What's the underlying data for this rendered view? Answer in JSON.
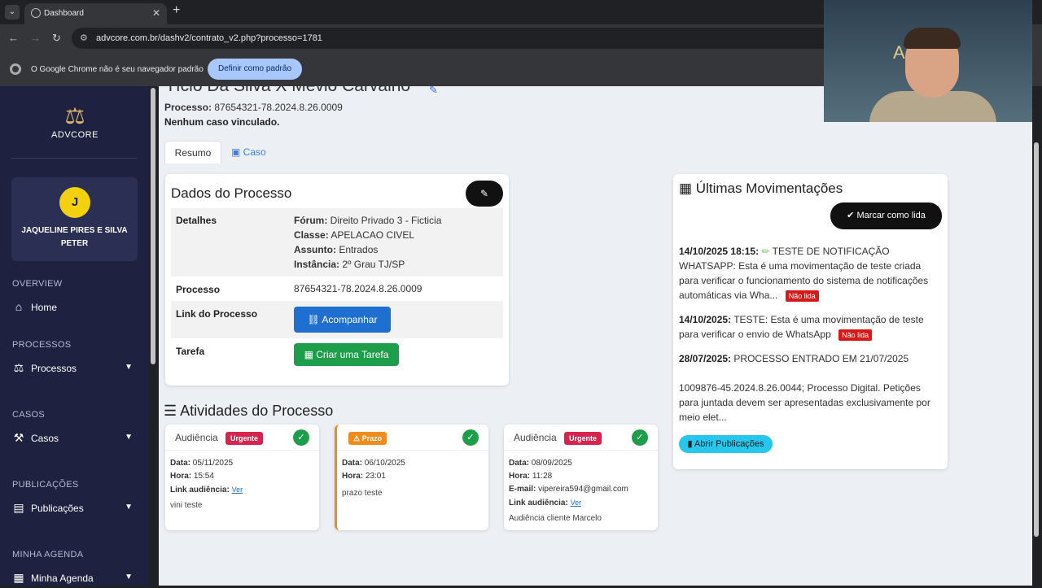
{
  "browser": {
    "tab_title": "Dashboard",
    "new_tab": "+",
    "close_tab": "✕",
    "url": "advcore.com.br/dashv2/contrato_v2.php?processo=1781",
    "infobar_message": "O Google Chrome não é seu navegador padrão",
    "infobar_button": "Definir como padrão"
  },
  "sidebar": {
    "logo_text": "ADVCORE",
    "user_initial": "J",
    "user_name": "JAQUELINE PIRES E SILVA PETER",
    "sections": {
      "overview": "OVERVIEW",
      "processos": "PROCESSOS",
      "casos": "CASOS",
      "publicacoes": "PUBLICAÇÕES",
      "agenda": "MINHA AGENDA"
    },
    "items": {
      "home": "Home",
      "processos": "Processos",
      "casos": "Casos",
      "publicacoes": "Publicações",
      "agenda": "Minha Agenda"
    }
  },
  "page": {
    "title": "Tício Da Silva X Mévio Carvalho",
    "processo_label": "Processo:",
    "processo_number": "87654321-78.2024.8.26.0009",
    "no_case": "Nenhum caso vinculado.",
    "tabs": {
      "resumo": "Resumo",
      "caso": "Caso"
    }
  },
  "dados": {
    "title": "Dados do Processo",
    "detalhes_label": "Detalhes",
    "forum_label": "Fórum:",
    "forum_value": "Direito Privado 3 - Ficticia",
    "classe_label": "Classe:",
    "classe_value": "APELACAO CIVEL",
    "assunto_label": "Assunto:",
    "assunto_value": "Entrados",
    "instancia_label": "Instância:",
    "instancia_value": "2º Grau TJ/SP",
    "processo_label": "Processo",
    "processo_value": "87654321-78.2024.8.26.0009",
    "link_label": "Link do Processo",
    "link_button": "Acompanhar",
    "tarefa_label": "Tarefa",
    "tarefa_button": "Criar uma Tarefa"
  },
  "atividades": {
    "title": "Atividades do Processo",
    "cards": [
      {
        "type": "Audiência",
        "badge": "Urgente",
        "data_label": "Data:",
        "data": "05/11/2025",
        "hora_label": "Hora:",
        "hora": "15:54",
        "link_label": "Link audiência:",
        "link": "Ver",
        "note": "vini teste"
      },
      {
        "type": "",
        "badge": "Prazo",
        "data_label": "Data:",
        "data": "06/10/2025",
        "hora_label": "Hora:",
        "hora": "23:01",
        "note": "prazo teste"
      },
      {
        "type": "Audiência",
        "badge": "Urgente",
        "data_label": "Data:",
        "data": "08/09/2025",
        "hora_label": "Hora:",
        "hora": "11:28",
        "email_label": "E-mail:",
        "email": "vipereira594@gmail.com",
        "link_label": "Link audiência:",
        "link": "Ver",
        "note": "Audiência cliente Marcelo"
      }
    ]
  },
  "ultimas": {
    "title": "Últimas Movimentações",
    "mark_button": "Marcar como lida",
    "items": [
      {
        "date": "14/10/2025 18:15:",
        "text": "TESTE DE NOTIFICAÇÃO WHATSAPP: Esta é uma movimentação de teste criada para verificar o funcionamento do sistema de notificações automáticas via Wha...",
        "badge": "Não lida"
      },
      {
        "date": "14/10/2025:",
        "text": "TESTE: Esta é uma movimentação de teste para verificar o envio de WhatsApp",
        "badge": "Não lida"
      },
      {
        "date": "28/07/2025:",
        "text": "PROCESSO ENTRADO EM 21/07/2025",
        "extra": "1009876-45.2024.8.26.0044; Processo Digital. Petições para juntada devem ser apresentadas exclusivamente por meio elet..."
      }
    ],
    "pub_button": "Abrir Publicações"
  },
  "webcam": {
    "brand": "ADV  E"
  },
  "colors": {
    "sidebar_bg": "#1e2140",
    "primary": "#1e6fd0",
    "success": "#1e9e4a",
    "danger": "#d6244f",
    "warning": "#f08c1e",
    "info": "#27c6ec"
  }
}
